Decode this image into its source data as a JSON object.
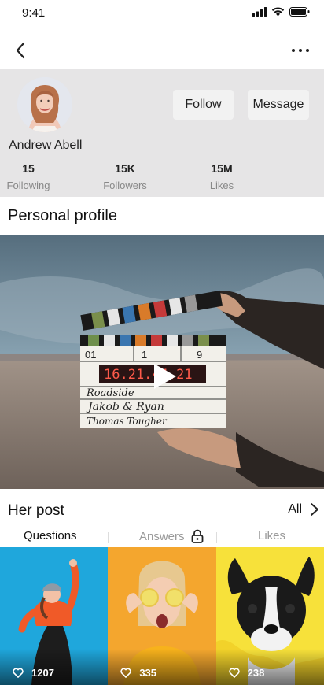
{
  "status_bar": {
    "time": "9:41"
  },
  "profile": {
    "name": "Andrew Abell",
    "follow_label": "Follow",
    "message_label": "Message",
    "stats": [
      {
        "value": "15",
        "label": "Following"
      },
      {
        "value": "15K",
        "label": "Followers"
      },
      {
        "value": "15M",
        "label": "Likes"
      }
    ]
  },
  "personal_profile_title": "Personal profile",
  "clapper": {
    "scene": "01",
    "take": "1",
    "roll": "9",
    "timecode": "16.21.44.21",
    "production": "Roadside",
    "director": "Jakob & Ryan",
    "camera": "Thomas Tougher"
  },
  "posts": {
    "title": "Her post",
    "all_label": "All",
    "tabs": [
      {
        "label": "Questions"
      },
      {
        "label": "Answers"
      },
      {
        "label": "Likes"
      }
    ],
    "items": [
      {
        "likes": "1207"
      },
      {
        "likes": "335"
      },
      {
        "likes": "238"
      }
    ]
  },
  "colors": {
    "header_bg": "#e6e5e6",
    "button_bg": "#f2f2f2",
    "muted": "#888888"
  }
}
